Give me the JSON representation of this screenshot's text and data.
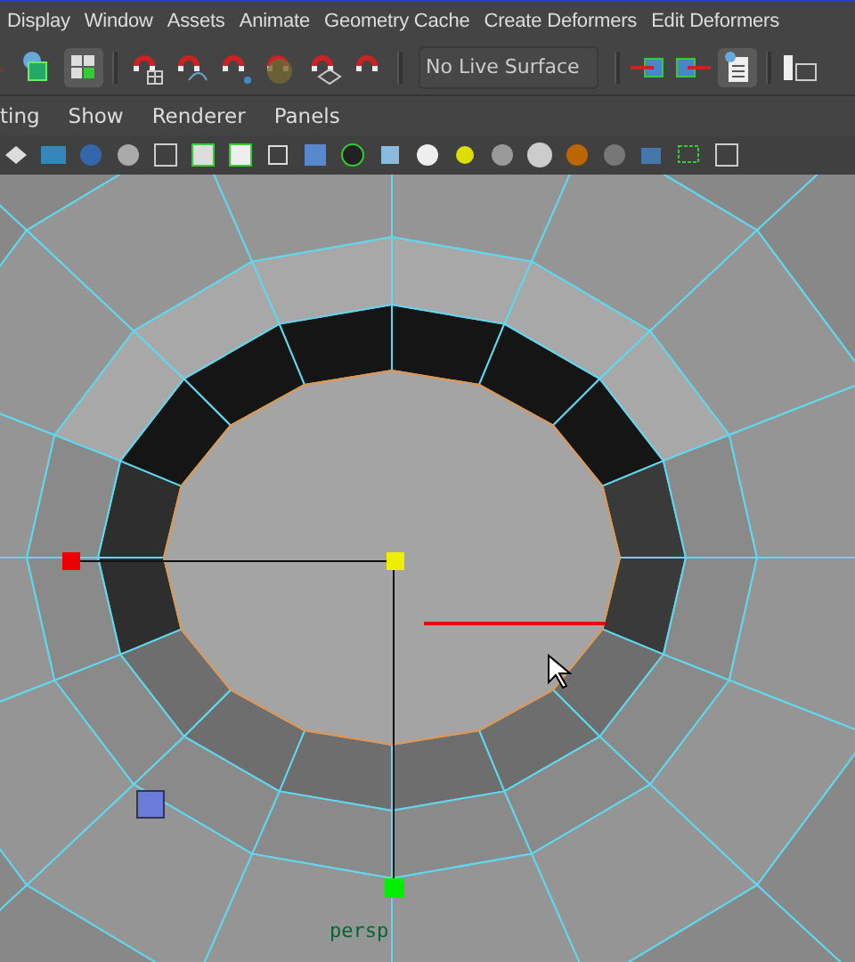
{
  "menu_bar": {
    "items": [
      "Display",
      "Window",
      "Assets",
      "Animate",
      "Geometry Cache",
      "Create Deformers",
      "Edit Deformers"
    ]
  },
  "status_line": {
    "live_surface": "No Live Surface"
  },
  "panel_menu": {
    "items": [
      "ting",
      "Show",
      "Renderer",
      "Panels"
    ]
  },
  "viewport": {
    "camera_label": "persp"
  }
}
